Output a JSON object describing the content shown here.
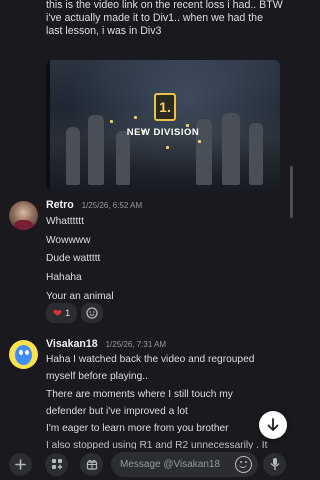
{
  "top_message": {
    "lines": [
      "this is the video link on the recent loss i had.. BTW",
      "i've actually made it to Div1.. when we had the",
      "last lesson, i was in Div3"
    ],
    "embed": {
      "badge": "1.",
      "title": "NEW DIVISION"
    }
  },
  "messages": [
    {
      "author": "Retro",
      "timestamp": "1/25/26, 6:52 AM",
      "lines": [
        "Whatttttt",
        "Wowwww",
        "Dude wattttt",
        "Hahaha",
        "Your an animal"
      ],
      "reactions": [
        {
          "emoji": "heart-icon",
          "count": "1",
          "color": "#e0323c"
        }
      ]
    },
    {
      "author": "Visakan18",
      "timestamp": "1/25/26, 7:31 AM",
      "lines": [
        "Haha I watched back the video and regrouped",
        "myself before playing..",
        "There are moments where I still touch  my",
        "defender but i've improved a lot",
        "I'm eager to learn more from you brother",
        "I also stopped using R1 and R2 unnecessarily . It"
      ]
    }
  ],
  "composer": {
    "placeholder": "Message @Visakan18",
    "buttons": [
      "plus-icon",
      "apps-icon",
      "gift-icon",
      "emoji-icon",
      "mic-icon"
    ]
  },
  "scroll_to_bottom": "arrow-down-icon",
  "colors": {
    "background": "#1a1a1e",
    "text": "#dbdee1",
    "muted": "#949ba4",
    "reaction_bg": "#2b2d31",
    "accent_gold": "#e8c24a"
  }
}
